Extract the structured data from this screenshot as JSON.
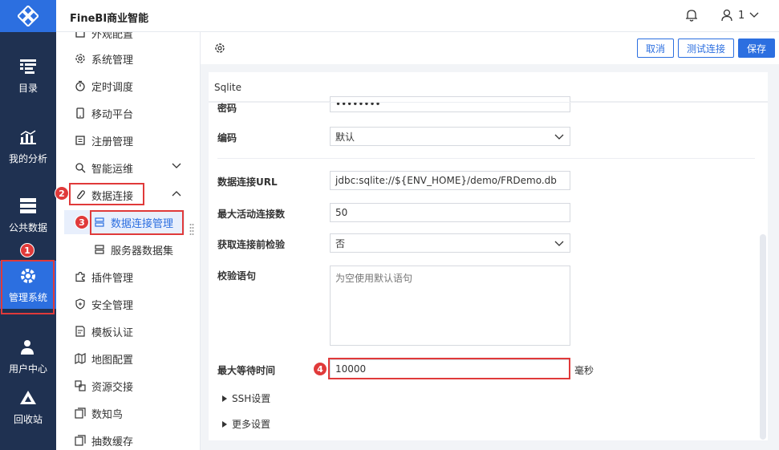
{
  "app_title": "FineBI商业智能",
  "user": {
    "name": "1"
  },
  "rail": [
    {
      "label": "目录"
    },
    {
      "label": "我的分析"
    },
    {
      "label": "公共数据"
    },
    {
      "label": "管理系统"
    },
    {
      "label": "用户中心"
    },
    {
      "label": "回收站"
    }
  ],
  "nav": {
    "items": [
      {
        "label": "外观配置"
      },
      {
        "label": "系统管理"
      },
      {
        "label": "定时调度"
      },
      {
        "label": "移动平台"
      },
      {
        "label": "注册管理"
      },
      {
        "label": "智能运维"
      },
      {
        "label": "数据连接"
      },
      {
        "label": "数据连接管理"
      },
      {
        "label": "服务器数据集"
      },
      {
        "label": "插件管理"
      },
      {
        "label": "安全管理"
      },
      {
        "label": "模板认证"
      },
      {
        "label": "地图配置"
      },
      {
        "label": "资源交接"
      },
      {
        "label": "数知鸟"
      },
      {
        "label": "抽数缓存"
      }
    ]
  },
  "toolbar": {
    "cancel": "取消",
    "test": "测试连接",
    "save": "保存"
  },
  "panel": {
    "title": "Sqlite",
    "password_label": "密码",
    "password_value": "••••••••",
    "encoding_label": "编码",
    "encoding_value": "默认",
    "url_label": "数据连接URL",
    "url_value": "jdbc:sqlite://${ENV_HOME}/demo/FRDemo.db",
    "max_active_label": "最大活动连接数",
    "max_active_value": "50",
    "validate_label": "获取连接前检验",
    "validate_value": "否",
    "query_label": "校验语句",
    "query_placeholder": "为空使用默认语句",
    "max_wait_label": "最大等待时间",
    "max_wait_value": "10000",
    "max_wait_unit": "毫秒",
    "ssh_label": "SSH设置",
    "more_label": "更多设置"
  },
  "callouts": [
    "1",
    "2",
    "3",
    "4"
  ],
  "colors": {
    "accent": "#2c6fe0",
    "rail": "#1f3151",
    "callout": "#e03a3a"
  }
}
